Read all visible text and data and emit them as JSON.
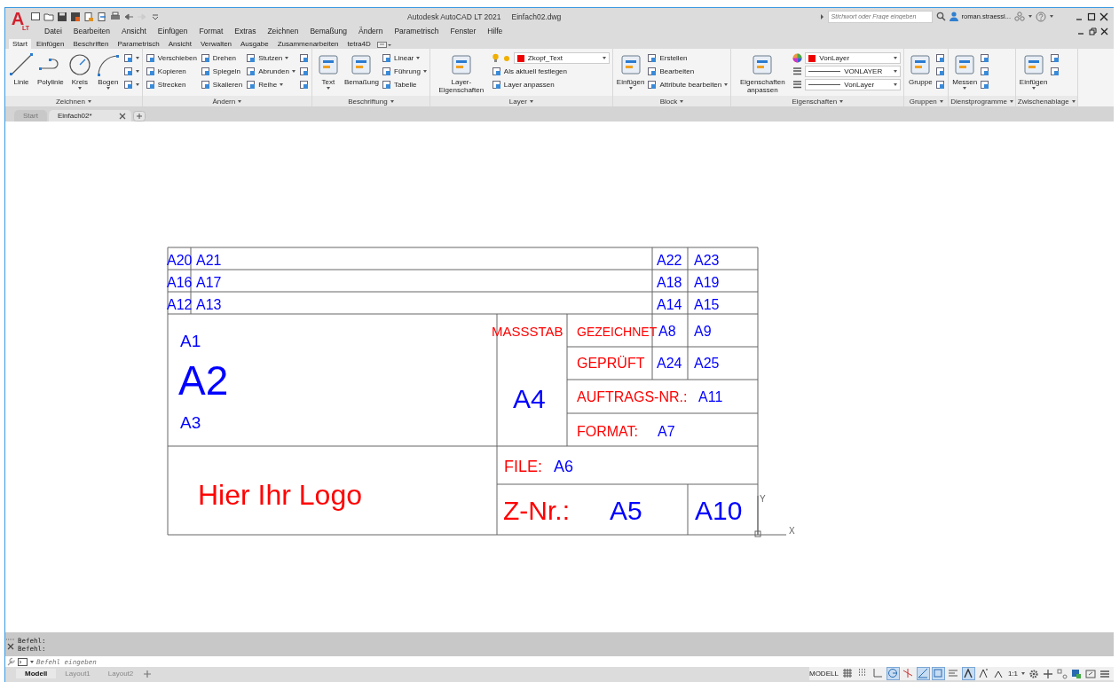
{
  "app": {
    "logo": "A",
    "edition": "LT",
    "title": "Autodesk AutoCAD LT 2021",
    "document": "Einfach02.dwg"
  },
  "search": {
    "placeholder": "Stichwort oder Frage eingeben"
  },
  "user": {
    "name": "roman.straessl..."
  },
  "menu": [
    "Datei",
    "Bearbeiten",
    "Ansicht",
    "Einfügen",
    "Format",
    "Extras",
    "Zeichnen",
    "Bemaßung",
    "Ändern",
    "Parametrisch",
    "Fenster",
    "Hilfe"
  ],
  "ribbon_tabs": [
    {
      "label": "Start",
      "selected": true
    },
    {
      "label": "Einfügen",
      "selected": false
    },
    {
      "label": "Beschriften",
      "selected": false
    },
    {
      "label": "Parametrisch",
      "selected": false
    },
    {
      "label": "Ansicht",
      "selected": false
    },
    {
      "label": "Verwalten",
      "selected": false
    },
    {
      "label": "Ausgabe",
      "selected": false
    },
    {
      "label": "Zusammenarbeiten",
      "selected": false
    },
    {
      "label": "tetra4D",
      "selected": false
    }
  ],
  "panels": [
    {
      "title": "Zeichnen",
      "items": [
        {
          "kind": "large",
          "label": "Linie",
          "menu": false
        },
        {
          "kind": "large",
          "label": "Polylinie",
          "menu": false
        },
        {
          "kind": "large",
          "label": "Kreis",
          "menu": true
        },
        {
          "kind": "large",
          "label": "Bogen",
          "menu": true
        },
        {
          "kind": "icon",
          "menu": true
        },
        {
          "kind": "icon",
          "menu": true
        },
        {
          "kind": "icon",
          "menu": true
        }
      ]
    },
    {
      "title": "Ändern",
      "items": [
        {
          "kind": "small",
          "label": "Verschieben",
          "menu": false
        },
        {
          "kind": "small",
          "label": "Kopieren",
          "menu": false
        },
        {
          "kind": "small",
          "label": "Strecken",
          "menu": false
        },
        {
          "kind": "small",
          "label": "Drehen",
          "menu": false
        },
        {
          "kind": "small",
          "label": "Spiegeln",
          "menu": false
        },
        {
          "kind": "small",
          "label": "Skalieren",
          "menu": false
        },
        {
          "kind": "small",
          "label": "Stutzen",
          "menu": true
        },
        {
          "kind": "small",
          "label": "Abrunden",
          "menu": true
        },
        {
          "kind": "small",
          "label": "Reihe",
          "menu": true
        },
        {
          "kind": "icon",
          "menu": false
        },
        {
          "kind": "icon",
          "menu": false
        },
        {
          "kind": "icon",
          "menu": false
        }
      ]
    },
    {
      "title": "Beschriftung",
      "items": [
        {
          "kind": "large",
          "label": "Text",
          "menu": true
        },
        {
          "kind": "large",
          "label": "Bemaßung",
          "menu": false
        },
        {
          "kind": "small",
          "label": "Linear",
          "menu": true
        },
        {
          "kind": "small",
          "label": "Führung",
          "menu": true
        },
        {
          "kind": "small",
          "label": "Tabelle",
          "menu": false
        }
      ]
    },
    {
      "title": "Layer",
      "items": [
        {
          "kind": "large",
          "label": "Layer-Eigenschaften",
          "menu": false
        },
        {
          "kind": "combo",
          "label": "Zkopf_Text",
          "menu": true
        },
        {
          "kind": "small",
          "label": "Als aktuell festlegen",
          "menu": false
        },
        {
          "kind": "small",
          "label": "Layer anpassen",
          "menu": false
        }
      ]
    },
    {
      "title": "Block",
      "items": [
        {
          "kind": "large",
          "label": "Einfügen",
          "menu": true
        },
        {
          "kind": "small",
          "label": "Erstellen",
          "menu": false
        },
        {
          "kind": "small",
          "label": "Bearbeiten",
          "menu": false
        },
        {
          "kind": "small",
          "label": "Attribute bearbeiten",
          "menu": true
        }
      ]
    },
    {
      "title": "Eigenschaften",
      "items": [
        {
          "kind": "large",
          "label": "Eigenschaften anpassen",
          "menu": false
        },
        {
          "kind": "color-combo",
          "label": "VonLayer",
          "menu": true
        },
        {
          "kind": "line-combo",
          "label": "VONLAYER",
          "menu": true
        },
        {
          "kind": "line-combo",
          "label": "VonLayer",
          "menu": true
        }
      ]
    },
    {
      "title": "Gruppen",
      "items": [
        {
          "kind": "large",
          "label": "Gruppe",
          "menu": false
        },
        {
          "kind": "icon",
          "menu": false
        },
        {
          "kind": "icon",
          "menu": false
        },
        {
          "kind": "icon",
          "menu": false
        }
      ]
    },
    {
      "title": "Dienstprogramme",
      "items": [
        {
          "kind": "large",
          "label": "Messen",
          "menu": true
        },
        {
          "kind": "icon",
          "menu": false
        },
        {
          "kind": "icon",
          "menu": false
        },
        {
          "kind": "icon",
          "menu": false
        }
      ]
    },
    {
      "title": "Zwischenablage",
      "items": [
        {
          "kind": "large",
          "label": "Einfügen",
          "menu": true
        },
        {
          "kind": "icon",
          "menu": false
        },
        {
          "kind": "icon",
          "menu": false
        }
      ]
    }
  ],
  "doc_tabs": [
    {
      "label": "Start",
      "selected": false
    },
    {
      "label": "Einfach02*",
      "selected": true
    }
  ],
  "drawing": {
    "texts": [
      {
        "text": "A20",
        "color": "#0000ff"
      },
      {
        "text": "A21",
        "color": "#0000ff"
      },
      {
        "text": "A22",
        "color": "#0000ff"
      },
      {
        "text": "A23",
        "color": "#0000ff"
      },
      {
        "text": "A16",
        "color": "#0000ff"
      },
      {
        "text": "A17",
        "color": "#0000ff"
      },
      {
        "text": "A18",
        "color": "#0000ff"
      },
      {
        "text": "A19",
        "color": "#0000ff"
      },
      {
        "text": "A12",
        "color": "#0000ff"
      },
      {
        "text": "A13",
        "color": "#0000ff"
      },
      {
        "text": "A14",
        "color": "#0000ff"
      },
      {
        "text": "A15",
        "color": "#0000ff"
      },
      {
        "text": "A1",
        "color": "#0000ff"
      },
      {
        "text": "A2",
        "color": "#0000ff"
      },
      {
        "text": "A3",
        "color": "#0000ff"
      },
      {
        "text": "MASSSTAB",
        "color": "#ff0000"
      },
      {
        "text": "GEZEICHNET",
        "color": "#ff0000"
      },
      {
        "text": "A8",
        "color": "#0000ff"
      },
      {
        "text": "A9",
        "color": "#0000ff"
      },
      {
        "text": "GEPRÜFT",
        "color": "#ff0000"
      },
      {
        "text": "A24",
        "color": "#0000ff"
      },
      {
        "text": "A25",
        "color": "#0000ff"
      },
      {
        "text": "A4",
        "color": "#0000ff"
      },
      {
        "text": "AUFTRAGS-NR.:",
        "color": "#ff0000"
      },
      {
        "text": "A11",
        "color": "#0000ff"
      },
      {
        "text": "FORMAT:",
        "color": "#ff0000"
      },
      {
        "text": "A7",
        "color": "#0000ff"
      },
      {
        "text": "FILE:",
        "color": "#ff0000"
      },
      {
        "text": "A6",
        "color": "#0000ff"
      },
      {
        "text": "Hier Ihr Logo",
        "color": "#ff0000"
      },
      {
        "text": "Z-Nr.:",
        "color": "#ff0000"
      },
      {
        "text": "A5",
        "color": "#0000ff"
      },
      {
        "text": "A10",
        "color": "#0000ff"
      }
    ],
    "ucs": {
      "x": "X",
      "y": "Y"
    }
  },
  "command": {
    "history": [
      "Befehl:",
      "Befehl:"
    ],
    "placeholder": "Befehl eingeben"
  },
  "layout_tabs": [
    {
      "label": "Modell",
      "selected": true
    },
    {
      "label": "Layout1",
      "selected": false
    },
    {
      "label": "Layout2",
      "selected": false
    }
  ],
  "status": {
    "space": "MODELL",
    "scale": "1:1",
    "toggles": [
      {
        "on": false
      },
      {
        "on": false
      },
      {
        "on": false
      },
      {
        "on": true
      },
      {
        "on": false
      },
      {
        "on": true
      },
      {
        "on": true
      },
      {
        "on": false
      },
      {
        "on": true
      },
      {
        "on": false
      },
      {
        "on": false
      }
    ]
  }
}
